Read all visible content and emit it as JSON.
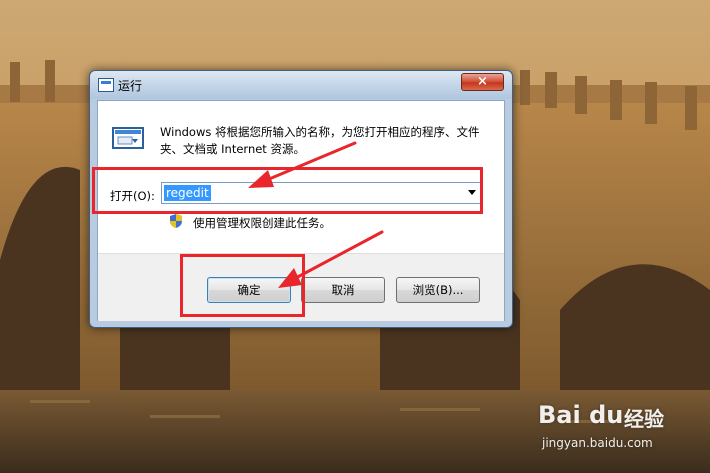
{
  "dialog": {
    "title": "运行",
    "close_label": "×",
    "description": "Windows 将根据您所输入的名称，为您打开相应的程序、文件夹、文档或 Internet 资源。",
    "open_label": "打开(O):",
    "open_value": "regedit",
    "admin_note": "使用管理权限创建此任务。",
    "buttons": {
      "ok": "确定",
      "cancel": "取消",
      "browse": "浏览(B)..."
    }
  },
  "watermark": {
    "brand": "Bai du",
    "cn": "经验",
    "url": "jingyan.baidu.com"
  },
  "colors": {
    "highlight": "#e8262b",
    "selection": "#3399ff",
    "close_button": "#c7351c"
  },
  "icons": [
    "run-program-icon",
    "shield-icon",
    "combo-arrow-icon",
    "close-icon"
  ]
}
